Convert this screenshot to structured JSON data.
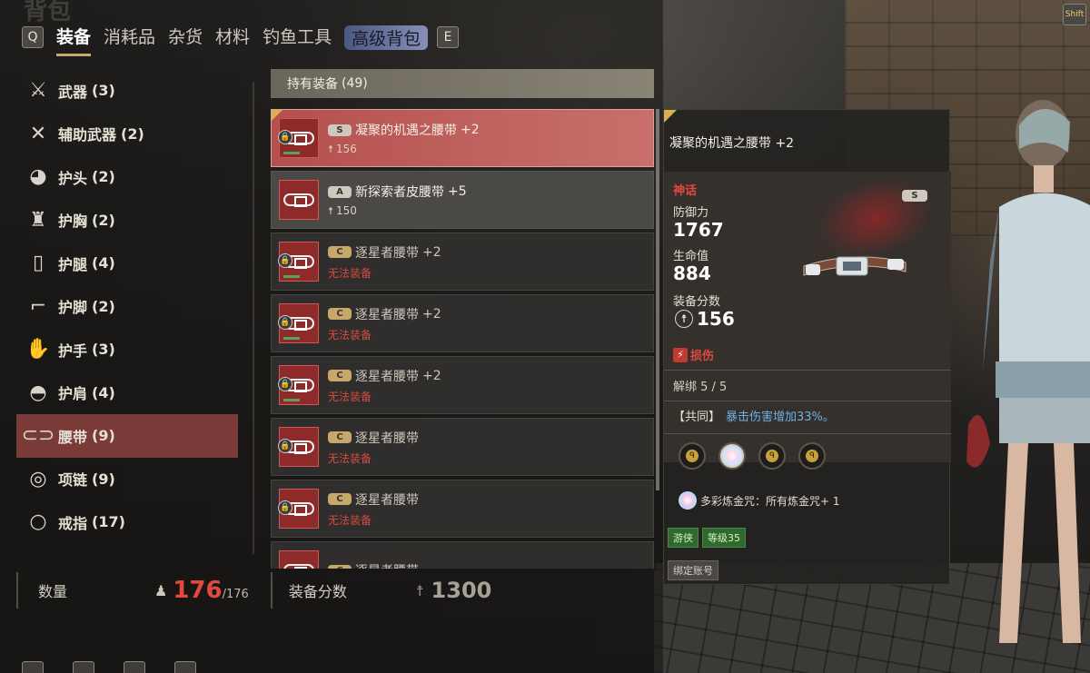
{
  "window": {
    "title_ghost": "背包"
  },
  "tabs": {
    "prev_key": "Q",
    "next_key": "E",
    "items": [
      {
        "label": "装备",
        "active": true
      },
      {
        "label": "消耗品"
      },
      {
        "label": "杂货"
      },
      {
        "label": "材料"
      },
      {
        "label": "钓鱼工具"
      },
      {
        "label": "高级背包"
      }
    ]
  },
  "shift_key": "Shift",
  "categories": [
    {
      "label": "武器",
      "count": "(3)",
      "icon": "sword-icon"
    },
    {
      "label": "辅助武器",
      "count": "(2)",
      "icon": "dagger-icon"
    },
    {
      "label": "护头",
      "count": "(2)",
      "icon": "helmet-icon"
    },
    {
      "label": "护胸",
      "count": "(2)",
      "icon": "chest-armor-icon"
    },
    {
      "label": "护腿",
      "count": "(4)",
      "icon": "leg-armor-icon"
    },
    {
      "label": "护脚",
      "count": "(2)",
      "icon": "boots-icon"
    },
    {
      "label": "护手",
      "count": "(3)",
      "icon": "gloves-icon"
    },
    {
      "label": "护肩",
      "count": "(4)",
      "icon": "shoulder-armor-icon"
    },
    {
      "label": "腰带",
      "count": "(9)",
      "icon": "belt-icon",
      "active": true
    },
    {
      "label": "项链",
      "count": "(9)",
      "icon": "necklace-icon"
    },
    {
      "label": "戒指",
      "count": "(17)",
      "icon": "ring-icon"
    }
  ],
  "list": {
    "header": "持有装备",
    "count": "(49)",
    "items": [
      {
        "grade": "S",
        "name": "凝聚的机遇之腰带",
        "plus": "+2",
        "sub": "156",
        "state": "selected"
      },
      {
        "grade": "A",
        "name": "新探索者皮腰带",
        "plus": "+5",
        "sub": "150",
        "state": "normal"
      },
      {
        "grade": "C",
        "name": "逐星者腰带",
        "plus": "+2",
        "sub": "无法装备",
        "state": "dim"
      },
      {
        "grade": "C",
        "name": "逐星者腰带",
        "plus": "+2",
        "sub": "无法装备",
        "state": "dim"
      },
      {
        "grade": "C",
        "name": "逐星者腰带",
        "plus": "+2",
        "sub": "无法装备",
        "state": "dim"
      },
      {
        "grade": "C",
        "name": "逐星者腰带",
        "plus": "",
        "sub": "无法装备",
        "state": "dim"
      },
      {
        "grade": "C",
        "name": "逐星者腰带",
        "plus": "",
        "sub": "无法装备",
        "state": "dim"
      },
      {
        "grade": "C",
        "name": "逐星者腰带",
        "plus": "",
        "sub": "",
        "state": "dim"
      }
    ]
  },
  "bottom": {
    "qty_label": "数量",
    "qty_value": "176",
    "qty_max": "/176",
    "gear_label": "装备分数",
    "gear_value": "1300"
  },
  "detail": {
    "title": "凝聚的机遇之腰带 +2",
    "grade_label": "神话",
    "grade_badge": "S",
    "defense_label": "防御力",
    "defense_value": "1767",
    "hp_label": "生命值",
    "hp_value": "884",
    "gearscore_label": "装备分数",
    "gearscore_value": "156",
    "damage_label": "损伤",
    "unbind": "解绑 5 / 5",
    "effect_prefix": "【共同】",
    "effect_text": "暴击伤害增加33%。",
    "alchemy": "多彩炼金咒：所有炼金咒+ 1",
    "tags": [
      "游侠",
      "等级35"
    ],
    "bound": "绑定账号"
  },
  "colors": {
    "accent_red": "#c9706c",
    "warn_red": "#e2483c",
    "effect_blue": "#6bb0e6",
    "gold": "#c8a96a"
  }
}
